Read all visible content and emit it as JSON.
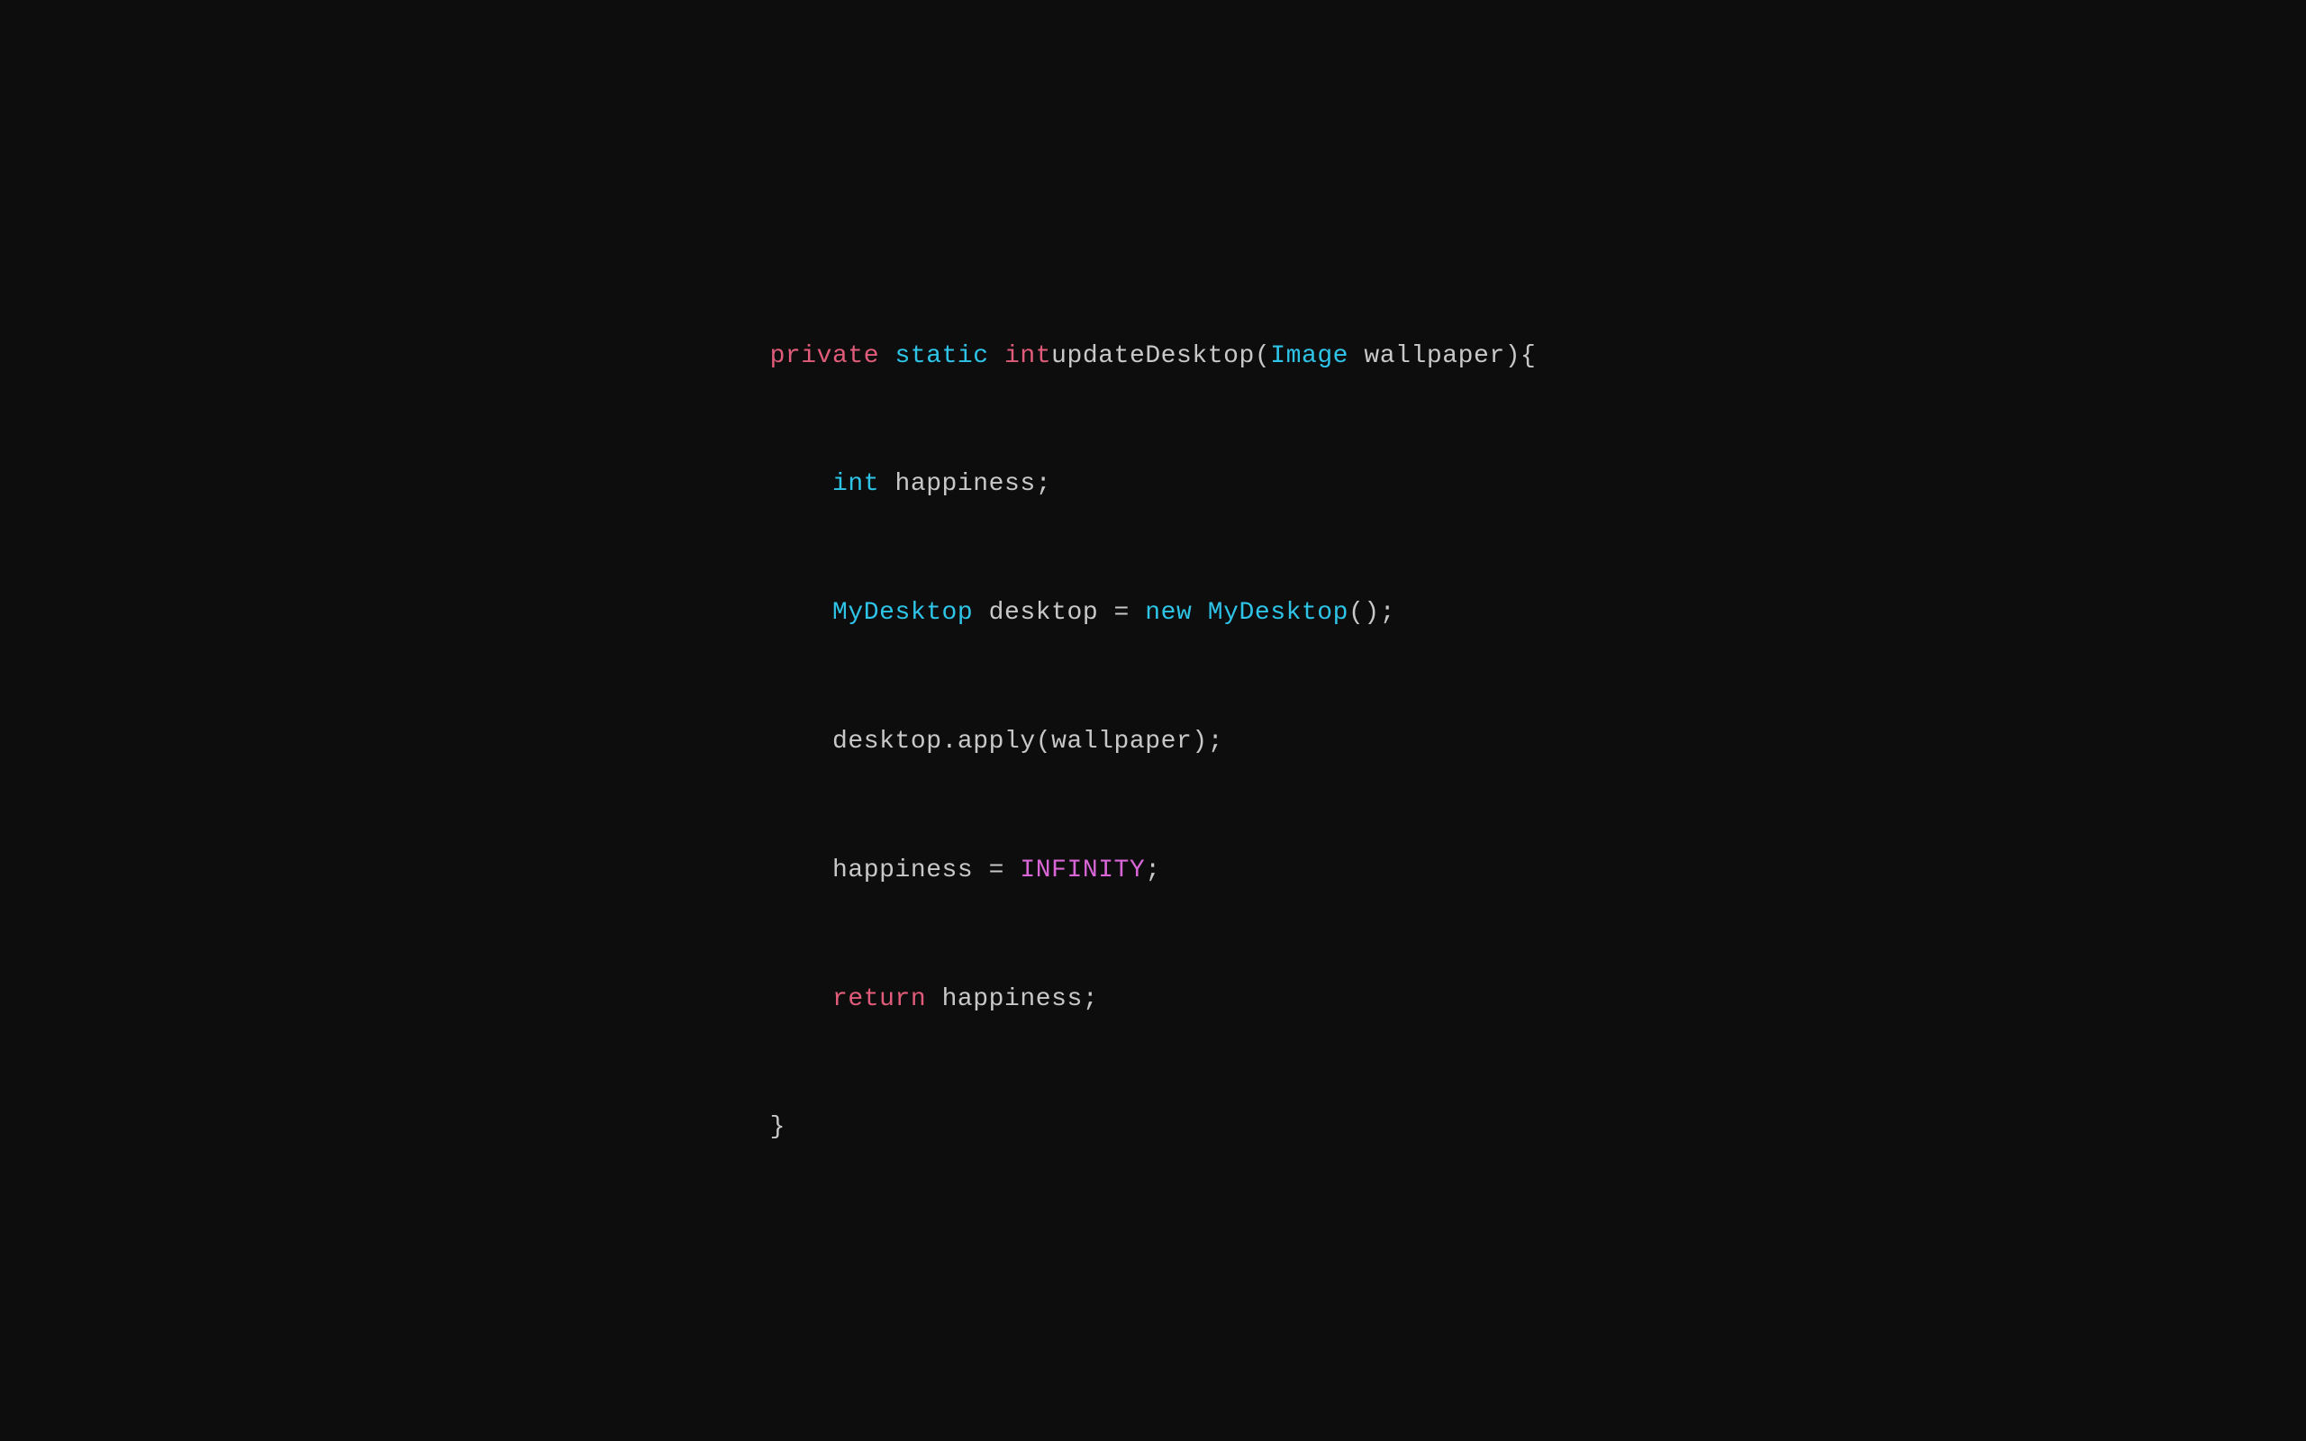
{
  "code": {
    "line1": {
      "private": "private",
      "space1": " ",
      "static": "static",
      "space2": " ",
      "int": "int",
      "space3": " ",
      "rest": "updateDesktop(",
      "image": "Image",
      "rest2": " wallpaper){"
    },
    "line2": {
      "indent": "    ",
      "int": "int",
      "rest": " happiness;"
    },
    "line3": {
      "indent": "    ",
      "mydesktop": "MyDesktop",
      "rest1": " desktop = ",
      "new": "new",
      "space": " ",
      "mydesktop2": "MyDesktop",
      "rest2": "();"
    },
    "line4": {
      "indent": "    ",
      "rest": "desktop.apply(wallpaper);"
    },
    "line5": {
      "indent": "    ",
      "rest1": "happiness = ",
      "infinity": "INFINITY",
      "rest2": ";"
    },
    "line6": {
      "indent": "    ",
      "return": "return",
      "rest": " happiness;"
    },
    "line7": {
      "brace": "}"
    }
  }
}
